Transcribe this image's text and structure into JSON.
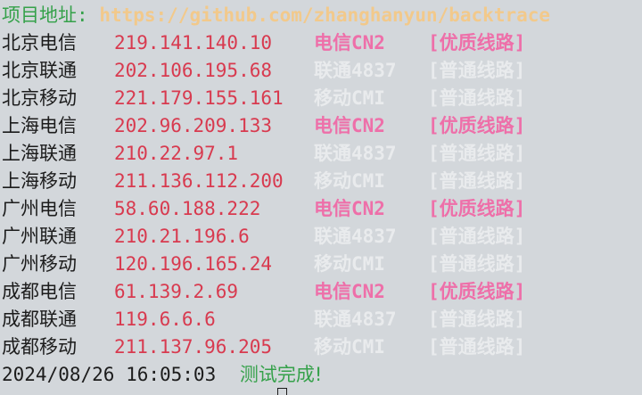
{
  "header": {
    "label": "项目地址:",
    "url": "https://github.com/zhanghanyun/backtrace"
  },
  "colors": {
    "background": "#d3d7db",
    "label_green": "#35a14a",
    "url_orange": "#f2c98b",
    "ip_red": "#d83a4f",
    "premium_pink": "#ee6fa9",
    "normal_white": "#e9ebed",
    "text_dark": "#1c1c1c"
  },
  "rows": [
    {
      "location": "北京电信",
      "ip": "219.141.140.10",
      "isp": "电信CN2",
      "quality": "[优质线路]",
      "tier": "premium"
    },
    {
      "location": "北京联通",
      "ip": "202.106.195.68",
      "isp": "联通4837",
      "quality": "[普通线路]",
      "tier": "normal"
    },
    {
      "location": "北京移动",
      "ip": "221.179.155.161",
      "isp": "移动CMI",
      "quality": "[普通线路]",
      "tier": "normal"
    },
    {
      "location": "上海电信",
      "ip": "202.96.209.133",
      "isp": "电信CN2",
      "quality": "[优质线路]",
      "tier": "premium"
    },
    {
      "location": "上海联通",
      "ip": "210.22.97.1",
      "isp": "联通4837",
      "quality": "[普通线路]",
      "tier": "normal"
    },
    {
      "location": "上海移动",
      "ip": "211.136.112.200",
      "isp": "移动CMI",
      "quality": "[普通线路]",
      "tier": "normal"
    },
    {
      "location": "广州电信",
      "ip": "58.60.188.222",
      "isp": "电信CN2",
      "quality": "[优质线路]",
      "tier": "premium"
    },
    {
      "location": "广州联通",
      "ip": "210.21.196.6",
      "isp": "联通4837",
      "quality": "[普通线路]",
      "tier": "normal"
    },
    {
      "location": "广州移动",
      "ip": "120.196.165.24",
      "isp": "移动CMI",
      "quality": "[普通线路]",
      "tier": "normal"
    },
    {
      "location": "成都电信",
      "ip": "61.139.2.69",
      "isp": "电信CN2",
      "quality": "[优质线路]",
      "tier": "premium"
    },
    {
      "location": "成都联通",
      "ip": "119.6.6.6",
      "isp": "联通4837",
      "quality": "[普通线路]",
      "tier": "normal"
    },
    {
      "location": "成都移动",
      "ip": "211.137.96.205",
      "isp": "移动CMI",
      "quality": "[普通线路]",
      "tier": "normal"
    }
  ],
  "footer": {
    "timestamp": "2024/08/26 16:05:03",
    "status": "测试完成!"
  }
}
